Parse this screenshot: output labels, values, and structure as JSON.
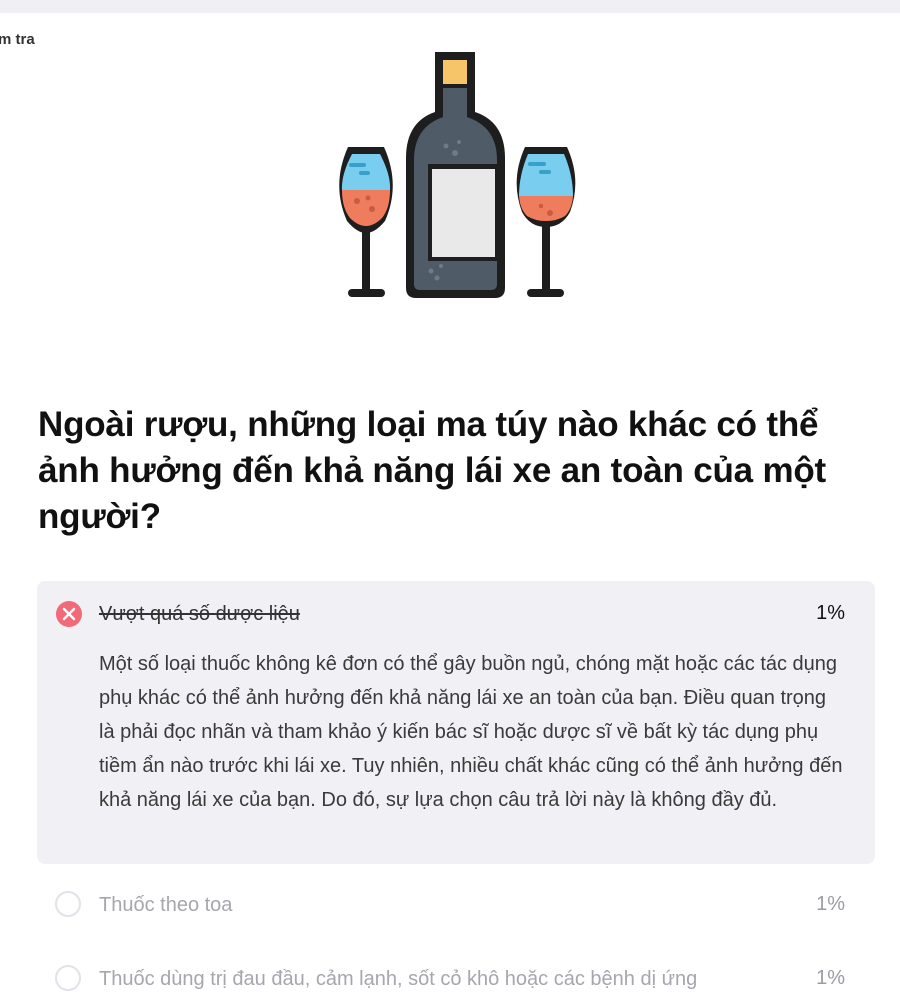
{
  "breadcrumb": "m tra",
  "illustration": {
    "icon": "wine-bottle-and-glasses-icon"
  },
  "question": "Ngoài rượu, những loại ma túy nào khác có thể ảnh hưởng đến khả năng lái xe an toàn của một người?",
  "selected_answer": {
    "label": "Vượt quá số dược liệu",
    "percent": "1%",
    "status": "incorrect",
    "explanation": "Một số loại thuốc không kê đơn có thể gây buồn ngủ, chóng mặt hoặc các tác dụng phụ khác có thể ảnh hưởng đến khả năng lái xe an toàn của bạn. Điều quan trọng là phải đọc nhãn và tham khảo ý kiến bác sĩ hoặc dược sĩ về bất kỳ tác dụng phụ tiềm ẩn nào trước khi lái xe. Tuy nhiên, nhiều chất khác cũng có thể ảnh hưởng đến khả năng lái xe của bạn. Do đó, sự lựa chọn câu trả lời này là không đầy đủ."
  },
  "options": [
    {
      "label": "Thuốc theo toa",
      "percent": "1%"
    },
    {
      "label": "Thuốc dùng trị đau đầu, cảm lạnh, sốt cỏ khô hoặc các bệnh dị ứng",
      "percent": "1%"
    }
  ],
  "colors": {
    "wrong": "#f06a78",
    "card_bg": "#f1f1f5",
    "muted_text": "#a6a6ad"
  }
}
